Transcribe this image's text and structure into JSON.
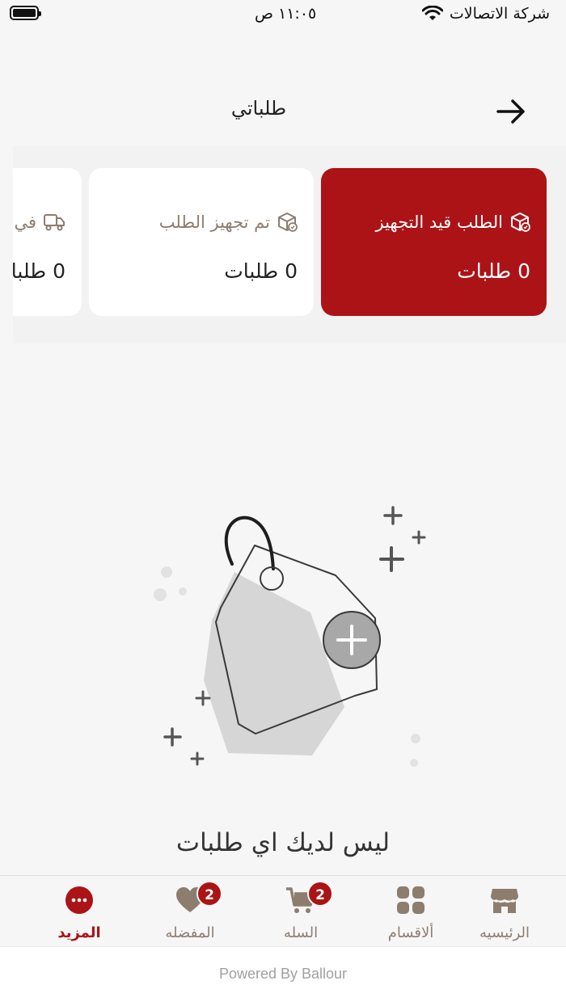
{
  "status_bar": {
    "carrier": "شركة الاتصالات",
    "time": "١١:٠٥ ص"
  },
  "header": {
    "title": "طلباتي"
  },
  "order_cards": [
    {
      "title": "الطلب قيد التجهيز",
      "count": "0 طلبات",
      "active": true
    },
    {
      "title": "تم تجهيز الطلب",
      "count": "0 طلبات",
      "active": false
    },
    {
      "title": "في",
      "count": "0 طلبا",
      "active": false
    }
  ],
  "empty_state": {
    "message": "ليس لديك اي طلبات"
  },
  "tabbar": {
    "items": [
      {
        "label": "الرئيسيه",
        "icon": "store-icon"
      },
      {
        "label": "ألاقسام",
        "icon": "grid-icon"
      },
      {
        "label": "السله",
        "icon": "cart-icon",
        "badge": "2"
      },
      {
        "label": "المفضله",
        "icon": "heart-icon",
        "badge": "2"
      },
      {
        "label": "المزيد",
        "icon": "more-icon",
        "active": true
      }
    ]
  },
  "footer": {
    "powered_by": "Powered By Ballour"
  },
  "colors": {
    "accent": "#ab1317",
    "muted_text": "#8d7d6f",
    "background": "#f6f6f6"
  }
}
